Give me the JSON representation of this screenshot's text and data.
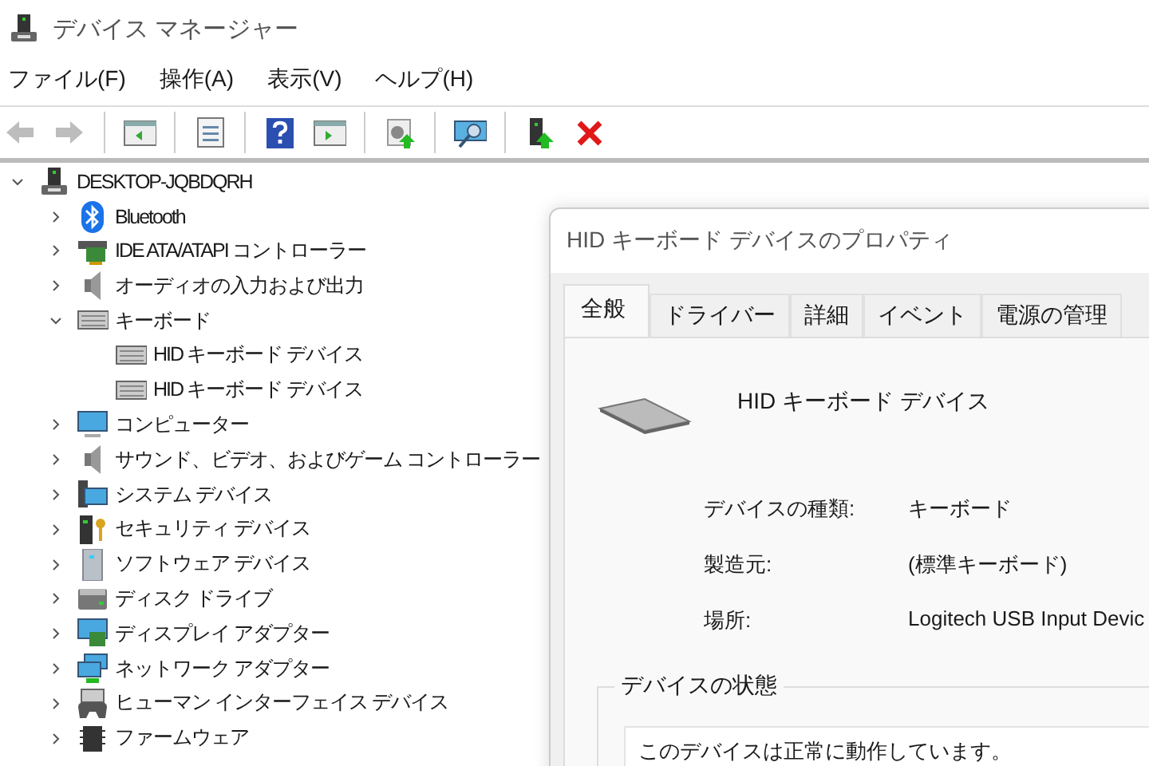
{
  "window": {
    "title": "デバイス マネージャー"
  },
  "menu": [
    "ファイル(F)",
    "操作(A)",
    "表示(V)",
    "ヘルプ(H)"
  ],
  "toolbar": {
    "groups": [
      {
        "buttons": [
          {
            "disabled": true
          },
          {
            "disabled": true
          }
        ]
      },
      {
        "buttons": [
          {
            "disabled": false
          }
        ]
      },
      {
        "buttons": [
          {
            "disabled": false
          }
        ]
      },
      {
        "buttons": [
          {
            "disabled": false
          },
          {
            "disabled": false
          }
        ]
      },
      {
        "buttons": [
          {
            "disabled": false
          }
        ]
      },
      {
        "buttons": [
          {
            "disabled": false
          }
        ]
      },
      {
        "buttons": [
          {
            "disabled": false
          },
          {
            "disabled": false
          }
        ]
      }
    ]
  },
  "tree": {
    "label": "DESKTOP-JQBDQRH",
    "expanded": true,
    "children": [
      {
        "label": "Bluetooth",
        "expanded": false
      },
      {
        "label": "IDE ATA/ATAPI コントローラー",
        "expanded": false
      },
      {
        "label": "オーディオの入力および出力",
        "expanded": false
      },
      {
        "label": "キーボード",
        "expanded": true,
        "children": [
          {
            "label": "HID キーボード デバイス"
          },
          {
            "label": "HID キーボード デバイス"
          }
        ]
      },
      {
        "label": "コンピューター",
        "expanded": false
      },
      {
        "label": "サウンド、ビデオ、およびゲーム コントローラー",
        "expanded": false
      },
      {
        "label": "システム デバイス",
        "expanded": false
      },
      {
        "label": "セキュリティ デバイス",
        "expanded": false
      },
      {
        "label": "ソフトウェア デバイス",
        "expanded": false
      },
      {
        "label": "ディスク ドライブ",
        "expanded": false
      },
      {
        "label": "ディスプレイ アダプター",
        "expanded": false
      },
      {
        "label": "ネットワーク アダプター",
        "expanded": false
      },
      {
        "label": "ヒューマン インターフェイス デバイス",
        "expanded": false
      },
      {
        "label": "ファームウェア",
        "expanded": false
      }
    ]
  },
  "dialog": {
    "title": "HID キーボード デバイスのプロパティ",
    "tabs": [
      {
        "label": "全般",
        "selected": true
      },
      {
        "label": "ドライバー",
        "selected": false
      },
      {
        "label": "詳細",
        "selected": false
      },
      {
        "label": "イベント",
        "selected": false
      },
      {
        "label": "電源の管理",
        "selected": false
      }
    ],
    "device_name": "HID キーボード デバイス",
    "properties": [
      {
        "label": "デバイスの種類:",
        "value": "キーボード"
      },
      {
        "label": "製造元:",
        "value": "(標準キーボード)"
      },
      {
        "label": "場所:",
        "value": "Logitech USB Input Devic"
      }
    ],
    "status": {
      "title": "デバイスの状態",
      "text": "このデバイスは正常に動作しています。"
    }
  }
}
